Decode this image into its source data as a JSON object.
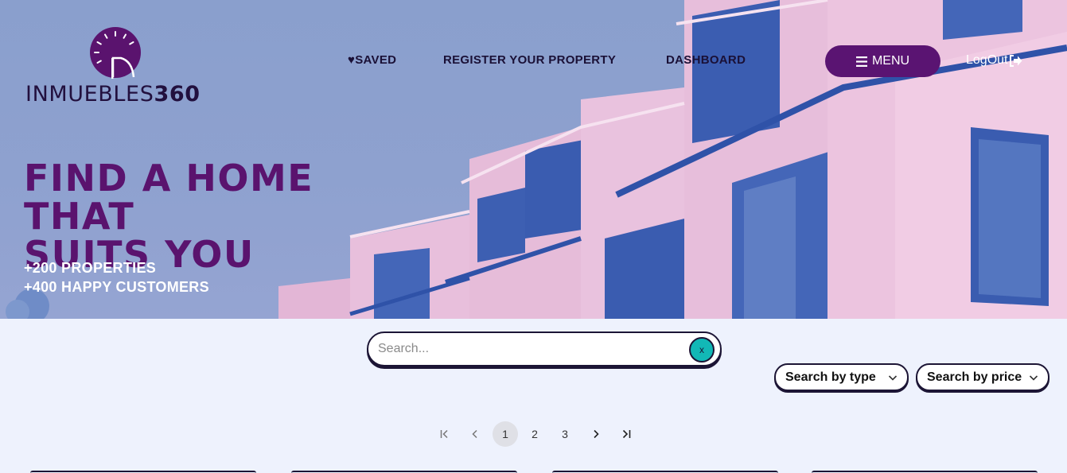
{
  "brand": {
    "name_light": "INMUEBLES",
    "name_bold": "360",
    "mark_color": "#5a136e"
  },
  "nav": {
    "saved": "♥SAVED",
    "register": "REGISTER YOUR PROPERTY",
    "dashboard": "DASHBOARD",
    "menu": "MENU",
    "logout": "LogOut"
  },
  "hero": {
    "headline_line1": "FIND A HOME THAT",
    "headline_line2": "SUITS YOU",
    "stat_properties": "+200 PROPERTIES",
    "stat_customers": "+400 HAPPY CUSTOMERS"
  },
  "search": {
    "placeholder": "Search...",
    "clear_label": "x"
  },
  "filters": {
    "type_label": "Search by type",
    "price_label": "Search by price"
  },
  "pagination": {
    "pages": [
      "1",
      "2",
      "3"
    ],
    "current": "1"
  },
  "colors": {
    "accent": "#5a136e",
    "teal": "#12b8b6",
    "ink": "#1c1535",
    "page_bg": "#eef2fd"
  },
  "icons": [
    "hamburger-icon",
    "logout-icon",
    "chevron-down-icon",
    "first-page-icon",
    "prev-page-icon",
    "next-page-icon",
    "last-page-icon"
  ]
}
